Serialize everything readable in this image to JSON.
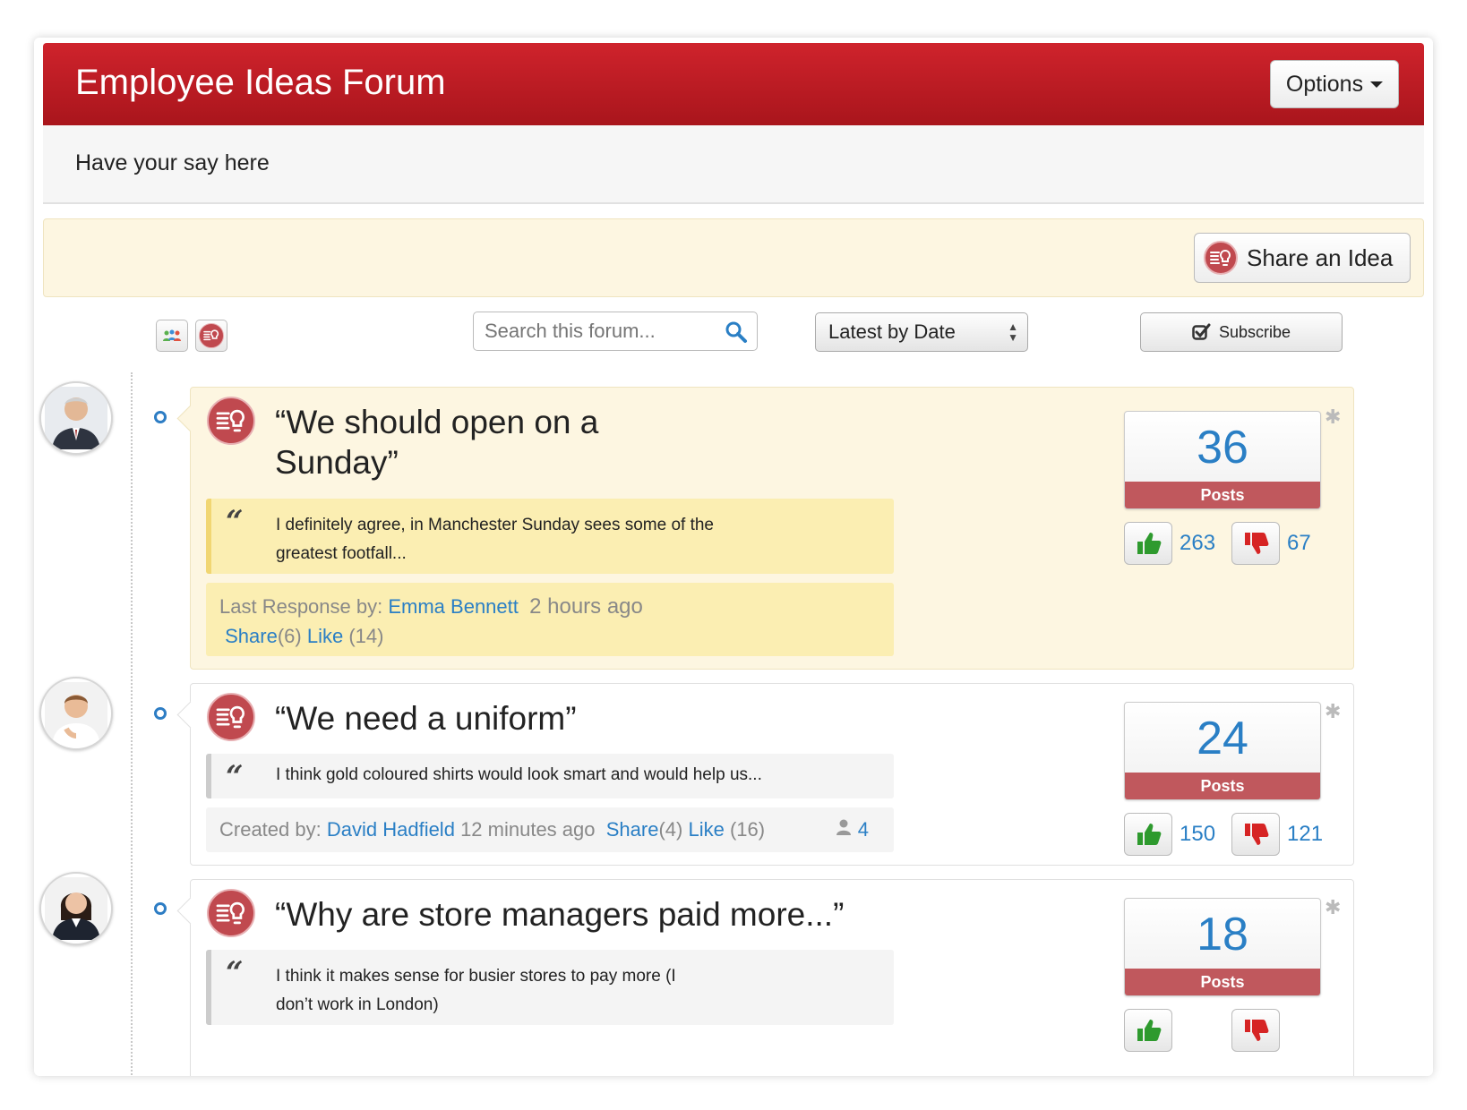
{
  "header": {
    "title": "Employee Ideas Forum",
    "options_label": "Options"
  },
  "subtitle": "Have your say here",
  "share_button": {
    "label": "Share an Idea"
  },
  "toolbar": {
    "search_placeholder": "Search this forum...",
    "sort_selected": "Latest by Date",
    "subscribe_label": "Subscribe"
  },
  "colors": {
    "brand_red": "#c41e26",
    "link_blue": "#2a7fc5",
    "highlight": "#fdf6e1"
  },
  "posts": [
    {
      "title": "“We should open on a Sunday”",
      "quote": "I definitely agree, in Manchester Sunday sees some of the greatest footfall...",
      "meta_prefix": "Last Response by:",
      "author": "Emma Bennett",
      "time": "2 hours ago",
      "share_label": "Share",
      "share_count": "(6)",
      "like_label": "Like",
      "like_count": "(14)",
      "posts_count": "36",
      "posts_label": "Posts",
      "up_votes": "263",
      "down_votes": "67"
    },
    {
      "title": "“We need a uniform”",
      "quote": "I think gold coloured shirts would look smart and would help us...",
      "meta_prefix": "Created by:",
      "author": "David Hadfield",
      "time": "12 minutes ago",
      "share_label": "Share",
      "share_count": "(4)",
      "like_label": "Like",
      "like_count": "(16)",
      "followers": "4",
      "posts_count": "24",
      "posts_label": "Posts",
      "up_votes": "150",
      "down_votes": "121"
    },
    {
      "title": "“Why are store managers paid more...”",
      "quote": "I think it makes sense for busier stores to pay more (I don’t work in London)",
      "posts_count": "18",
      "posts_label": "Posts"
    }
  ]
}
